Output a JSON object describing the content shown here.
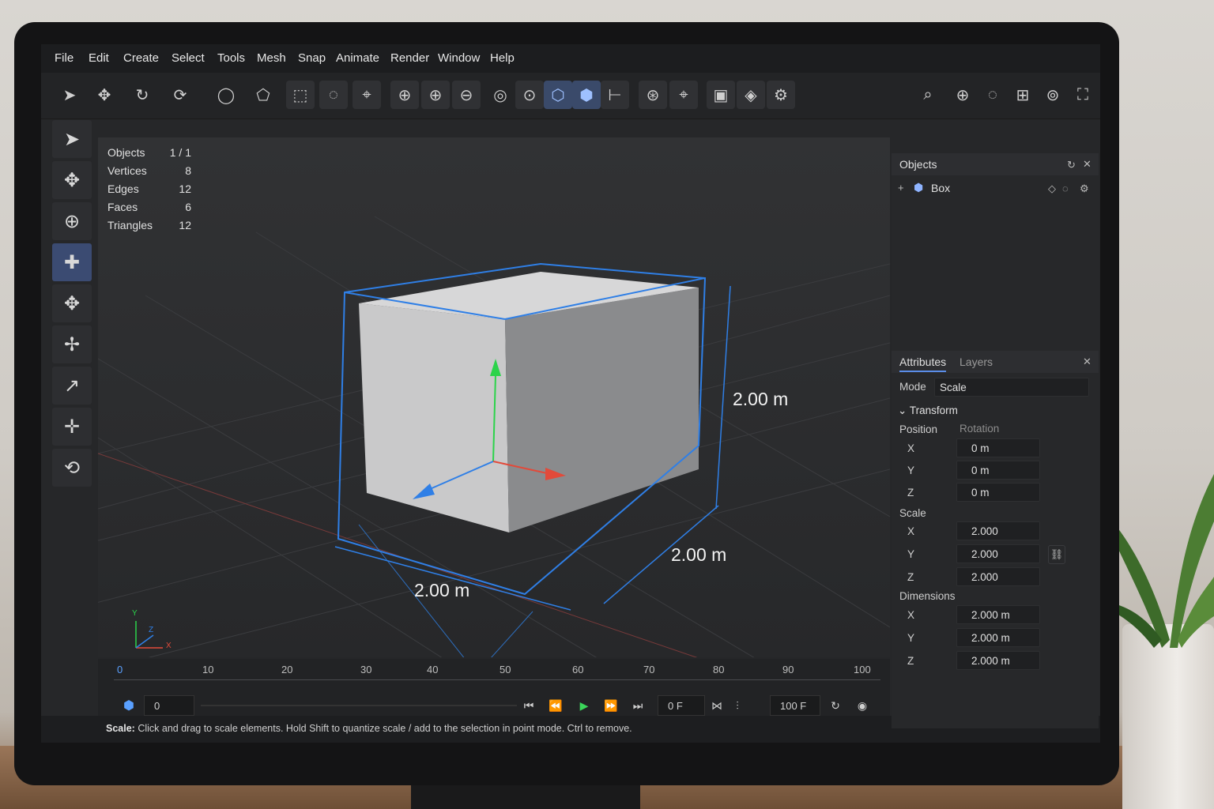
{
  "menu": [
    "File",
    "Edit",
    "Create",
    "Select",
    "Tools",
    "Mesh",
    "Snap",
    "Animate",
    "Render",
    "Window",
    "Help"
  ],
  "toolbar_icons": [
    "select-arrow-icon",
    "move-icon",
    "rotate-icon",
    "redo-rotate-icon",
    "lasso-icon",
    "polygon-select-icon",
    "box-select-icon",
    "circle-select-icon",
    "path-select-icon",
    "scale-snap-icon",
    "move-snap-icon",
    "rotate-snap-icon",
    "pivot-icon",
    "local-axis-icon",
    "object-axis-icon",
    "cube-axis-icon",
    "align-icon",
    "add-point-icon",
    "crosshair-icon",
    "cube-front-icon",
    "cube-side-icon",
    "cube-settings-icon",
    "search-icon",
    "zoom-icon",
    "orbit-icon",
    "grid-icon",
    "camera-icon",
    "maximize-icon"
  ],
  "stats": [
    {
      "label": "Objects",
      "value": "1 / 1"
    },
    {
      "label": "Vertices",
      "value": "8"
    },
    {
      "label": "Edges",
      "value": "12"
    },
    {
      "label": "Faces",
      "value": "6"
    },
    {
      "label": "Triangles",
      "value": "12"
    }
  ],
  "dimensions": {
    "height": "2.00 m",
    "depth": "2.00 m",
    "width": "2.00 m"
  },
  "gizmo": {
    "x": "X",
    "y": "Y",
    "z": "Z"
  },
  "timeline": {
    "ticks": [
      "0",
      "10",
      "20",
      "30",
      "40",
      "50",
      "60",
      "70",
      "80",
      "90",
      "100"
    ],
    "current": "0",
    "frame_start": "0",
    "current_frame": "0 F",
    "end_frame": "100 F"
  },
  "status": {
    "mode": "Scale:",
    "hint": " Click and drag to scale elements. Hold Shift to quantize scale / add to the selection in point mode. Ctrl to remove."
  },
  "objects_panel": {
    "title": "Objects",
    "items": [
      {
        "name": "Box"
      }
    ]
  },
  "attributes": {
    "tabs": [
      "Attributes",
      "Layers"
    ],
    "mode_label": "Mode",
    "mode_value": "Scale",
    "section": "Transform",
    "position_label": "Position",
    "rotation_label": "Rotation",
    "position": [
      {
        "axis": "X",
        "value": "0 m"
      },
      {
        "axis": "Y",
        "value": "0 m"
      },
      {
        "axis": "Z",
        "value": "0 m"
      }
    ],
    "scale_label": "Scale",
    "scale": [
      {
        "axis": "X",
        "value": "2.000"
      },
      {
        "axis": "Y",
        "value": "2.000"
      },
      {
        "axis": "Z",
        "value": "2.000"
      }
    ],
    "dimensions_label": "Dimensions",
    "dimensions": [
      {
        "axis": "X",
        "value": "2.000 m"
      },
      {
        "axis": "Y",
        "value": "2.000 m"
      },
      {
        "axis": "Z",
        "value": "2.000 m"
      }
    ]
  }
}
